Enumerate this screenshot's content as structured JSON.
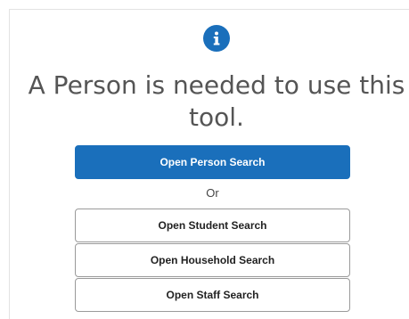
{
  "icons": {
    "info": "info-icon"
  },
  "colors": {
    "primary": "#1a6fbb",
    "message_text": "#555555"
  },
  "message": {
    "text": "A Person is needed to use this tool."
  },
  "actions": {
    "person_search_label": "Open Person Search",
    "or_label": "Or",
    "student_search_label": "Open Student Search",
    "household_search_label": "Open Household Search",
    "staff_search_label": "Open Staff Search"
  }
}
